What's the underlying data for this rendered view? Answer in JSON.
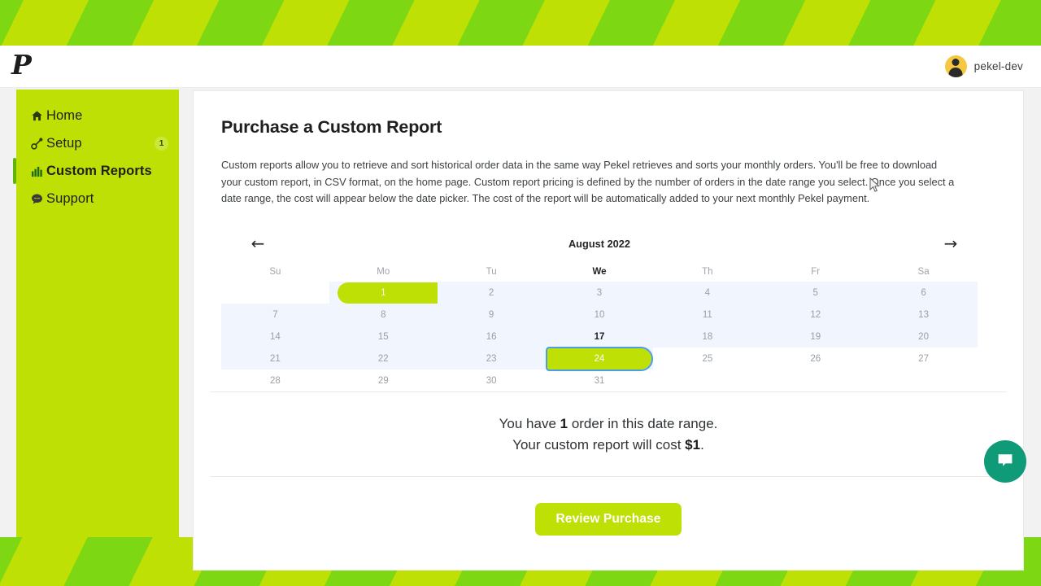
{
  "topbar": {
    "brand_logo": "P",
    "user_name": "pekel-dev"
  },
  "sidebar": {
    "items": [
      {
        "label": "Home",
        "icon": "home-icon",
        "badge": null,
        "active": false
      },
      {
        "label": "Setup",
        "icon": "wrench-icon",
        "badge": "1",
        "active": false
      },
      {
        "label": "Custom Reports",
        "icon": "chart-icon",
        "badge": null,
        "active": true
      },
      {
        "label": "Support",
        "icon": "chat-icon",
        "badge": null,
        "active": false
      }
    ]
  },
  "main": {
    "title": "Purchase a Custom Report",
    "description": "Custom reports allow you to retrieve and sort historical order data in the same way Pekel retrieves and sorts your monthly orders. You'll be free to download your custom report, in CSV format, on the home page. Custom report pricing is defined by the number of orders in the date range you select. Once you select a date range, the cost will appear below the date picker. The cost of the report will be automatically added to your next monthly Pekel payment."
  },
  "calendar": {
    "month_label": "August 2022",
    "prev_arrow": "←",
    "next_arrow": "→",
    "weekdays": [
      "Su",
      "Mo",
      "Tu",
      "We",
      "Th",
      "Fr",
      "Sa"
    ],
    "today_weekday_index": 3,
    "today_day": 17,
    "range_start": 1,
    "range_end": 24,
    "weeks": [
      [
        null,
        1,
        2,
        3,
        4,
        5,
        6
      ],
      [
        7,
        8,
        9,
        10,
        11,
        12,
        13
      ],
      [
        14,
        15,
        16,
        17,
        18,
        19,
        20
      ],
      [
        21,
        22,
        23,
        24,
        25,
        26,
        27
      ],
      [
        28,
        29,
        30,
        31,
        null,
        null,
        null
      ]
    ]
  },
  "summary": {
    "line1_pre": "You have ",
    "line1_count": "1",
    "line1_post": " order in this date range.",
    "line2_pre": "Your custom report will cost ",
    "line2_cost": "$1",
    "line2_post": "."
  },
  "cta": {
    "label": "Review Purchase"
  },
  "chat": {
    "icon": "chat-bubble-icon"
  },
  "colors": {
    "brand_green": "#bfe005",
    "stripe_green_dark": "#7ed713",
    "stripe_green_light": "#bfe005",
    "range_highlight": "#f0f5fe",
    "focus_blue": "#4a9ee8",
    "chat_teal": "#0f9a78",
    "avatar_yellow": "#f5c842"
  }
}
